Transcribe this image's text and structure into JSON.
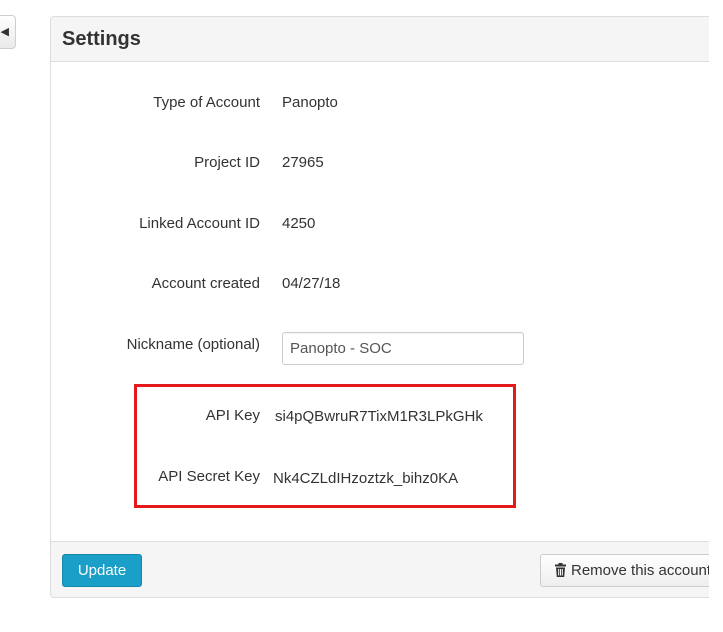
{
  "panel": {
    "title": "Settings"
  },
  "fields": [
    {
      "label": "Type of Account",
      "value": "Panopto"
    },
    {
      "label": "Project ID",
      "value": "27965"
    },
    {
      "label": "Linked Account ID",
      "value": "4250"
    },
    {
      "label": "Account created",
      "value": "04/27/18"
    }
  ],
  "nickname": {
    "label": "Nickname (optional)",
    "value": "Panopto - SOC"
  },
  "api": {
    "key_label": "API Key",
    "key_value": "si4pQBwruR7TixM1R3LPkGHk",
    "secret_label": "API Secret Key",
    "secret_value": "Nk4CZLdIHzoztzk_bihz0KA"
  },
  "footer": {
    "update_label": "Update",
    "remove_label": "Remove this account"
  },
  "icons": {
    "back": "caret-left-icon",
    "remove": "trash-icon"
  },
  "colors": {
    "primary_button": "#1a9fc8",
    "highlight": "#e3191b"
  }
}
